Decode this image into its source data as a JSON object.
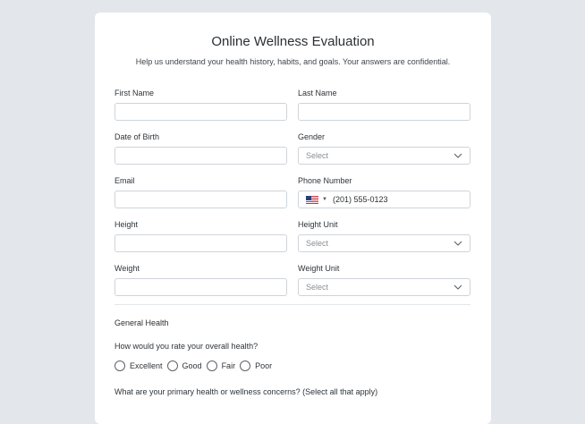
{
  "form": {
    "title": "Online Wellness Evaluation",
    "subtitle": "Help us understand your health history, habits, and goals. Your answers are confidential.",
    "fields": {
      "first_name": {
        "label": "First Name",
        "value": ""
      },
      "last_name": {
        "label": "Last Name",
        "value": ""
      },
      "dob": {
        "label": "Date of Birth",
        "value": ""
      },
      "gender": {
        "label": "Gender",
        "placeholder": "Select"
      },
      "email": {
        "label": "Email",
        "value": ""
      },
      "phone": {
        "label": "Phone Number",
        "value": "(201) 555-0123",
        "country_icon": "us-flag-icon"
      },
      "height": {
        "label": "Height",
        "value": ""
      },
      "height_unit": {
        "label": "Height Unit",
        "placeholder": "Select"
      },
      "weight": {
        "label": "Weight",
        "value": ""
      },
      "weight_unit": {
        "label": "Weight Unit",
        "placeholder": "Select"
      }
    },
    "general_health": {
      "section_title": "General Health",
      "overall_question": "How would you rate your overall health?",
      "options": [
        "Excellent",
        "Good",
        "Fair",
        "Poor"
      ],
      "concerns_question": "What are your primary health or wellness concerns? (Select all that apply)"
    }
  },
  "colors": {
    "background": "#e3e7eb",
    "card": "#ffffff",
    "border": "#cfd4d9",
    "text": "#2b2f33"
  }
}
